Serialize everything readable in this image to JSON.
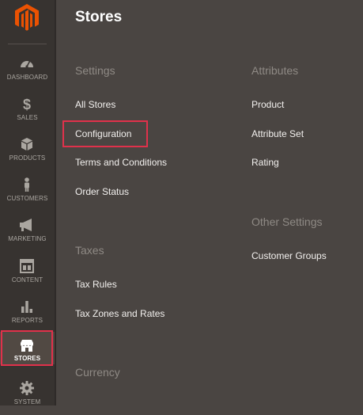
{
  "sidebar": {
    "logo_icon": "magento-logo-icon",
    "accent_color": "#eb5202",
    "items": [
      {
        "label": "DASHBOARD",
        "icon": "speedometer-icon"
      },
      {
        "label": "SALES",
        "icon": "dollar-icon"
      },
      {
        "label": "PRODUCTS",
        "icon": "box-icon"
      },
      {
        "label": "CUSTOMERS",
        "icon": "person-icon"
      },
      {
        "label": "MARKETING",
        "icon": "megaphone-icon"
      },
      {
        "label": "CONTENT",
        "icon": "layout-icon"
      },
      {
        "label": "REPORTS",
        "icon": "bar-chart-icon"
      },
      {
        "label": "STORES",
        "icon": "storefront-icon",
        "active": true
      },
      {
        "label": "SYSTEM",
        "icon": "gear-icon"
      }
    ]
  },
  "panel": {
    "title": "Stores",
    "settings": {
      "title": "Settings",
      "links": [
        "All Stores",
        "Configuration",
        "Terms and Conditions",
        "Order Status"
      ]
    },
    "taxes": {
      "title": "Taxes",
      "links": [
        "Tax Rules",
        "Tax Zones and Rates"
      ]
    },
    "currency": {
      "title": "Currency"
    },
    "attributes": {
      "title": "Attributes",
      "links": [
        "Product",
        "Attribute Set",
        "Rating"
      ]
    },
    "other_settings": {
      "title": "Other Settings",
      "links": [
        "Customer Groups"
      ]
    }
  },
  "highlight_color": "#e0314b"
}
